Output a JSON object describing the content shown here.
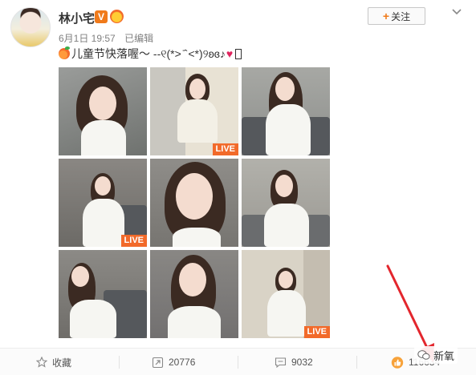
{
  "post": {
    "username": "林小宅",
    "verified_badge": "V",
    "date": "6月1日 19:57",
    "edited_label": "已编辑",
    "text_main": "儿童节快落喔～ -  ",
    "text_kaomoji": "-୧(*> ᷄`<*)୨ʚɞ♪",
    "follow_label": "关注",
    "follow_plus": "+",
    "images": [
      {
        "live": false
      },
      {
        "live": true,
        "live_label": "LIVE"
      },
      {
        "live": false
      },
      {
        "live": true,
        "live_label": "LIVE"
      },
      {
        "live": false
      },
      {
        "live": false
      },
      {
        "live": false
      },
      {
        "live": false
      },
      {
        "live": true,
        "live_label": "LIVE"
      }
    ]
  },
  "actions": {
    "favorite_label": "收藏",
    "repost_count": "20776",
    "comment_count": "9032",
    "like_count": "116634"
  },
  "watermark": {
    "text": "新氧"
  },
  "colors": {
    "accent_orange": "#f26a2a",
    "arrow_red": "#e3262d",
    "verified_orange": "#f07a1a"
  }
}
